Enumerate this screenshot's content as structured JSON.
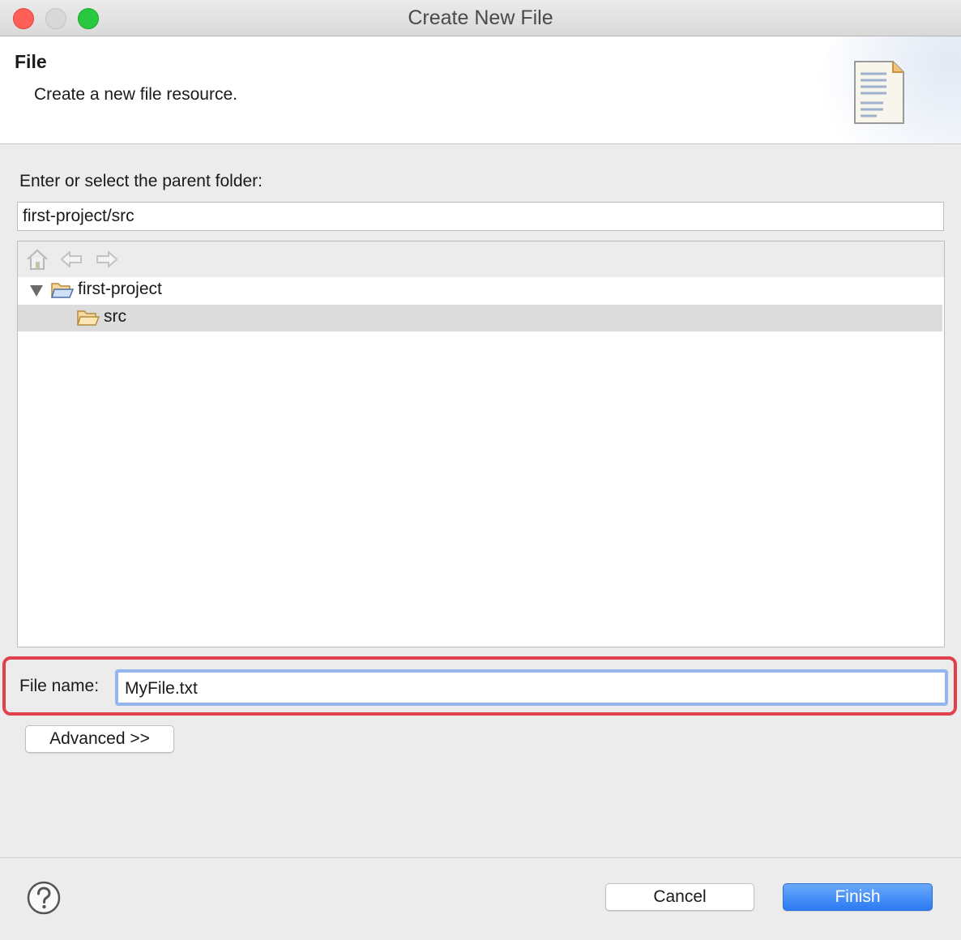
{
  "window": {
    "title": "Create New File"
  },
  "banner": {
    "title": "File",
    "description": "Create a new file resource.",
    "icon": "document-icon"
  },
  "parent_folder": {
    "label": "Enter or select the parent folder:",
    "value": "first-project/src"
  },
  "tree": {
    "toolbar": [
      "home-icon",
      "back-arrow-icon",
      "forward-arrow-icon"
    ],
    "items": [
      {
        "label": "first-project",
        "expanded": true,
        "icon": "open-project-folder-icon"
      },
      {
        "label": "src",
        "selected": true,
        "icon": "open-folder-icon"
      }
    ]
  },
  "file_name": {
    "label": "File name:",
    "value": "MyFile.txt"
  },
  "buttons": {
    "advanced": "Advanced >>",
    "cancel": "Cancel",
    "finish": "Finish"
  },
  "colors": {
    "highlight_box": "#e0414d",
    "finish_button": "#2b7bf3",
    "selected_row": "#dcdcdc"
  }
}
